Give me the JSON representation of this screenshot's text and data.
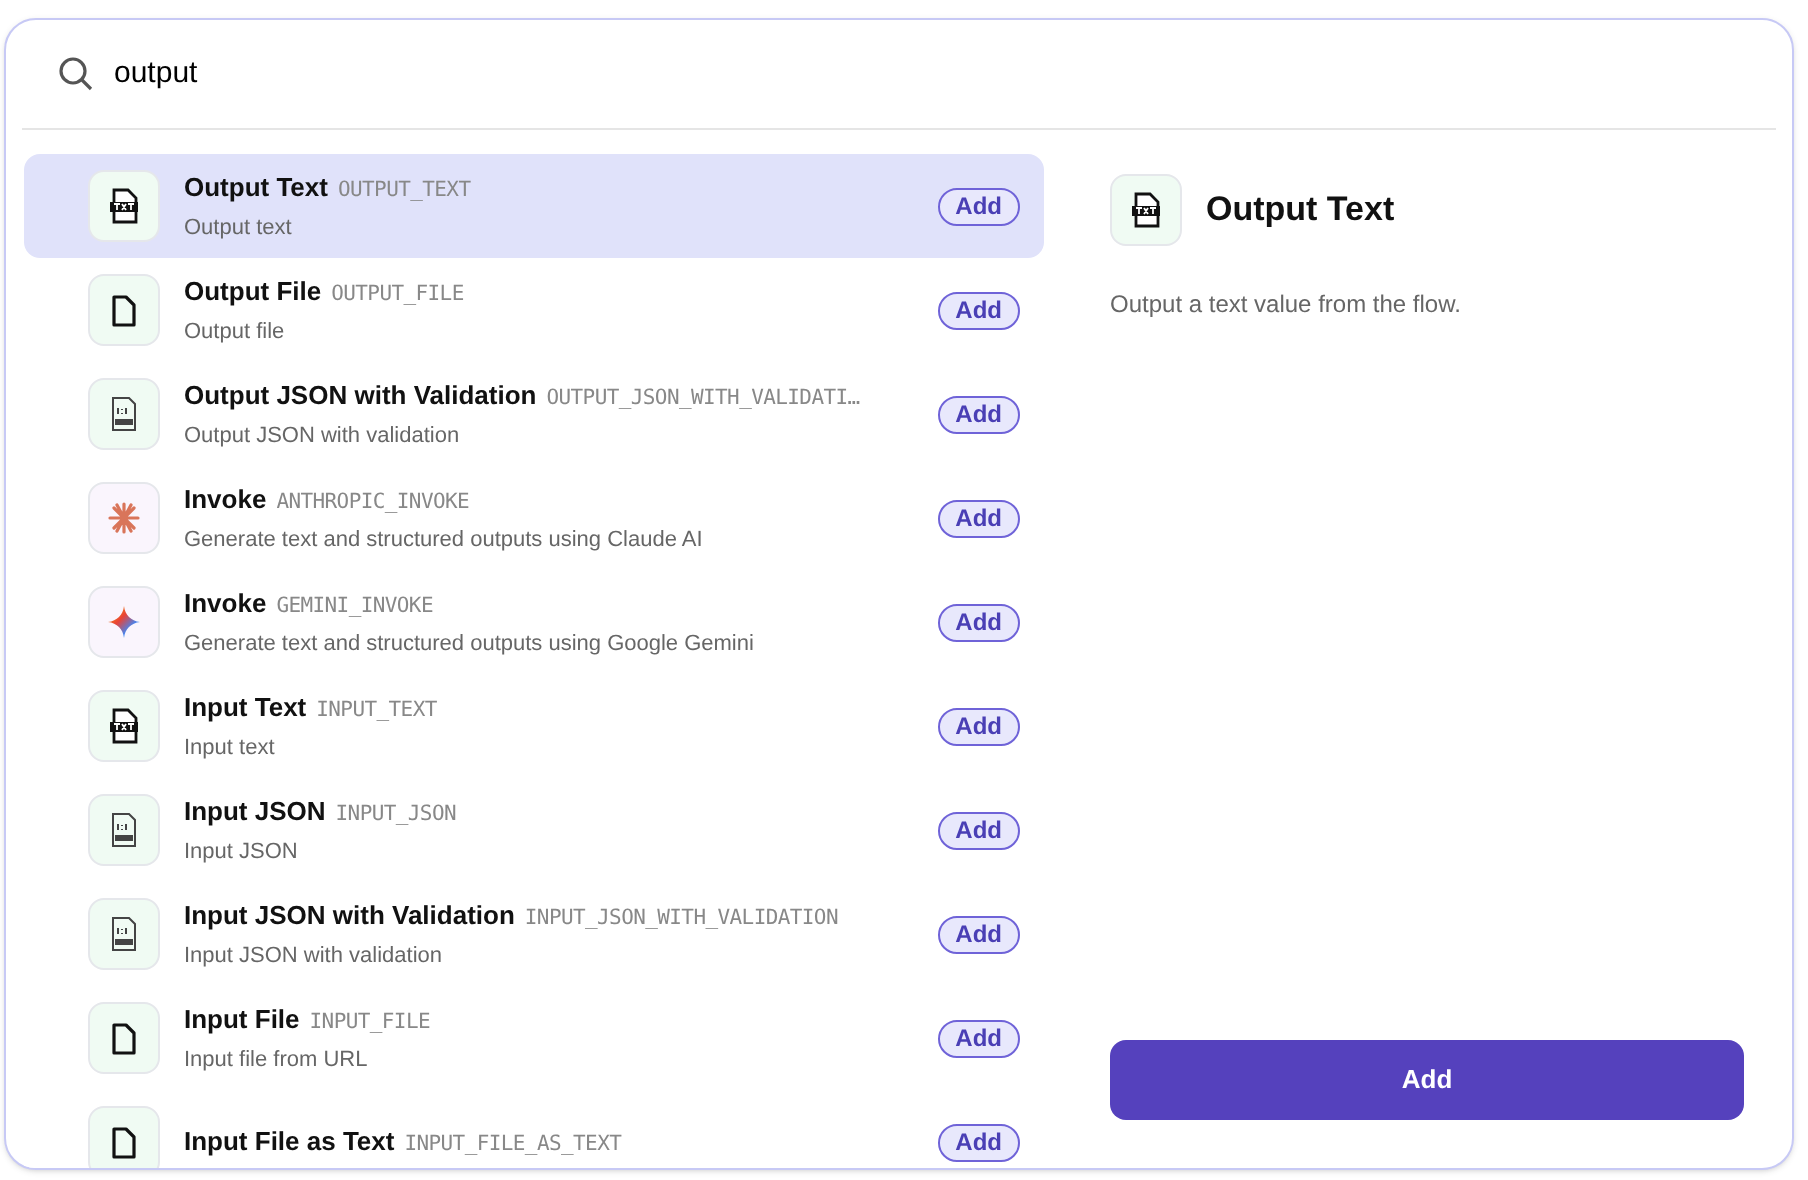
{
  "search": {
    "value": "output"
  },
  "items": [
    {
      "title": "Output Text",
      "code": "OUTPUT_TEXT",
      "description": "Output text",
      "kind": "text",
      "selected": true,
      "button": "Add"
    },
    {
      "title": "Output File",
      "code": "OUTPUT_FILE",
      "description": "Output file",
      "kind": "file",
      "selected": false,
      "button": "Add"
    },
    {
      "title": "Output JSON with Validation",
      "code": "OUTPUT_JSON_WITH_VALIDATI…",
      "description": "Output JSON with validation",
      "kind": "json",
      "selected": false,
      "button": "Add"
    },
    {
      "title": "Invoke",
      "code": "ANTHROPIC_INVOKE",
      "description": "Generate text and structured outputs using Claude AI",
      "kind": "anthropic",
      "selected": false,
      "button": "Add"
    },
    {
      "title": "Invoke",
      "code": "GEMINI_INVOKE",
      "description": "Generate text and structured outputs using Google Gemini",
      "kind": "gemini",
      "selected": false,
      "button": "Add"
    },
    {
      "title": "Input Text",
      "code": "INPUT_TEXT",
      "description": "Input text",
      "kind": "text",
      "selected": false,
      "button": "Add"
    },
    {
      "title": "Input JSON",
      "code": "INPUT_JSON",
      "description": "Input JSON",
      "kind": "json",
      "selected": false,
      "button": "Add"
    },
    {
      "title": "Input JSON with Validation",
      "code": "INPUT_JSON_WITH_VALIDATION",
      "description": "Input JSON with validation",
      "kind": "json",
      "selected": false,
      "button": "Add"
    },
    {
      "title": "Input File",
      "code": "INPUT_FILE",
      "description": "Input file from URL",
      "kind": "file",
      "selected": false,
      "button": "Add"
    },
    {
      "title": "Input File as Text",
      "code": "INPUT_FILE_AS_TEXT",
      "kind": "file",
      "selected": false,
      "button": "Add"
    }
  ],
  "detail": {
    "title": "Output Text",
    "kind": "text",
    "description": "Output a text value from the flow.",
    "button": "Add"
  }
}
